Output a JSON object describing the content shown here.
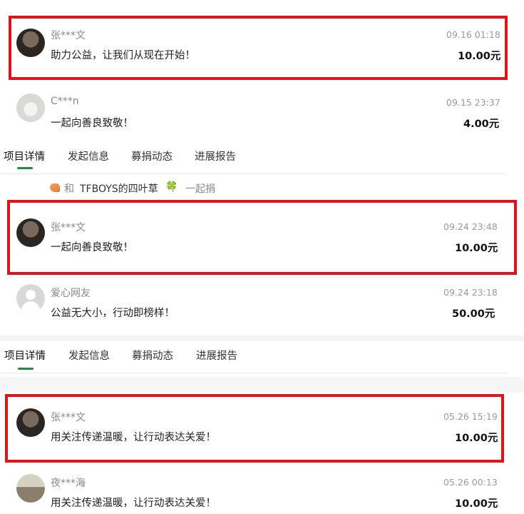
{
  "tabs": {
    "details": "项目详情",
    "initiator": "发起信息",
    "donations": "募捐动态",
    "progress": "进展报告"
  },
  "group": {
    "and_label": "和",
    "fan_group": "TFBOYS的四叶草",
    "clover": "🍀",
    "together_label": "一起捐"
  },
  "records": [
    {
      "name": "张***文",
      "time": "09.16 01:18",
      "message": "助力公益，让我们从现在开始！",
      "amount": "10.00元"
    },
    {
      "name": "C***n",
      "time": "09.15 23:37",
      "message": "一起向善良致敬！",
      "amount": "4.00元"
    },
    {
      "name": "张***文",
      "time": "09.24 23:48",
      "message": "一起向善良致敬！",
      "amount": "10.00元"
    },
    {
      "name": "爱心网友",
      "time": "09.24 23:18",
      "message": "公益无大小，行动即榜样！",
      "amount": "50.00元"
    },
    {
      "name": "张***文",
      "time": "05.26 15:19",
      "message": "用关注传递温暖，让行动表达关爱！",
      "amount": "10.00元"
    },
    {
      "name": "夜***海",
      "time": "05.26 00:13",
      "message": "用关注传递温暖，让行动表达关爱！",
      "amount": "10.00元"
    }
  ],
  "colors": {
    "highlight_border": "#e1121a",
    "tab_indicator": "#1d8f3b"
  }
}
